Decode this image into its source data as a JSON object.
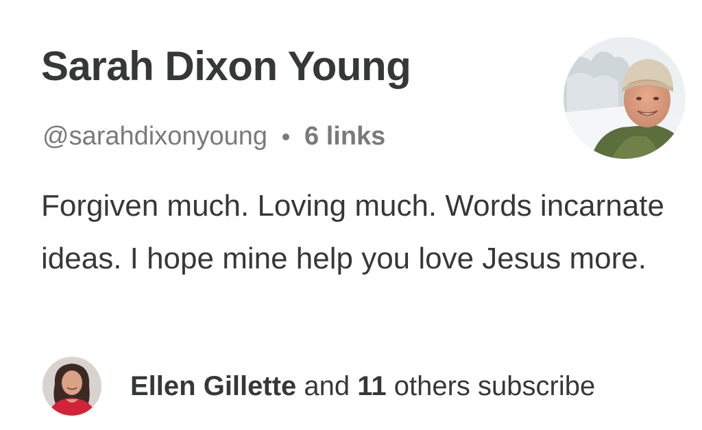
{
  "profile": {
    "name": "Sarah Dixon Young",
    "handle": "@sarahdixonyoung",
    "separator_icon": "bullet-dot-icon",
    "links_count": "6 links",
    "bio": "Forgiven much. Loving much. Words incarnate ideas. I hope mine help you love Jesus more.",
    "avatar_icon": "profile-photo"
  },
  "subscribers": {
    "avatar_icon": "subscriber-photo",
    "first_name": "Ellen Gillette",
    "and_text": "and",
    "others_count": "11",
    "suffix_text": "others subscribe"
  },
  "colors": {
    "text_primary": "#363737",
    "text_secondary": "#7a7a7a",
    "background": "#ffffff"
  }
}
